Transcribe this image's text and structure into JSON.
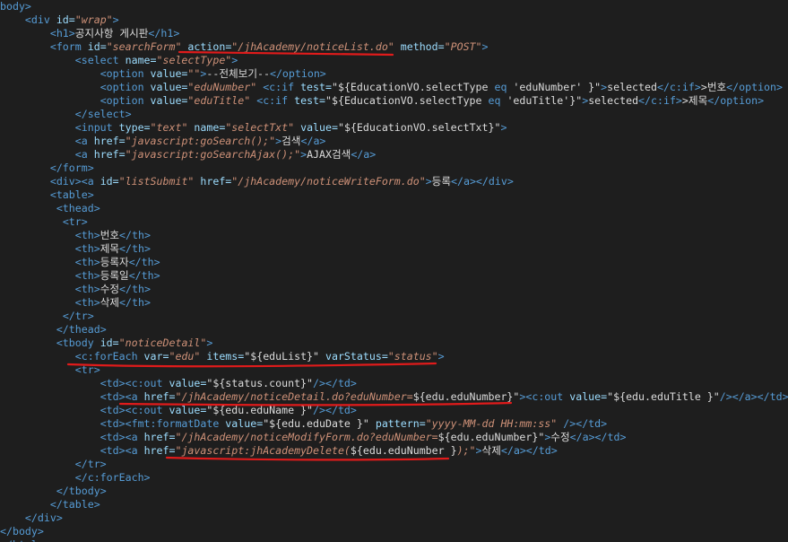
{
  "code_lines": [
    [
      [
        "tag",
        "body>"
      ]
    ],
    [
      [
        "txt",
        "    "
      ],
      [
        "tag",
        "<div "
      ],
      [
        "attr",
        "id="
      ],
      [
        "str",
        "\"wrap\""
      ],
      [
        "tag",
        ">"
      ]
    ],
    [
      [
        "txt",
        "        "
      ],
      [
        "tag",
        "<h1>"
      ],
      [
        "txt",
        "공지사항 게시판"
      ],
      [
        "tag",
        "</h1>"
      ]
    ],
    [
      [
        "txt",
        "        "
      ],
      [
        "tag",
        "<form "
      ],
      [
        "attr",
        "id="
      ],
      [
        "str",
        "\"searchForm\""
      ],
      [
        "attr",
        " action="
      ],
      [
        "str",
        "\"/jhAcademy/noticeList.do\""
      ],
      [
        "attr",
        " method="
      ],
      [
        "str",
        "\"POST\""
      ],
      [
        "tag",
        ">"
      ]
    ],
    [
      [
        "txt",
        "            "
      ],
      [
        "tag",
        "<select "
      ],
      [
        "attr",
        "name="
      ],
      [
        "str",
        "\"selectType\""
      ],
      [
        "tag",
        ">"
      ]
    ],
    [
      [
        "txt",
        "                "
      ],
      [
        "tag",
        "<option "
      ],
      [
        "attr",
        "value="
      ],
      [
        "str",
        "\"\""
      ],
      [
        "tag",
        ">"
      ],
      [
        "txt",
        "--전체보기--"
      ],
      [
        "tag",
        "</option>"
      ]
    ],
    [
      [
        "txt",
        "                "
      ],
      [
        "tag",
        "<option "
      ],
      [
        "attr",
        "value="
      ],
      [
        "str",
        "\"eduNumber\""
      ],
      [
        "txt",
        " "
      ],
      [
        "tag",
        "<c:if "
      ],
      [
        "attr",
        "test="
      ],
      [
        "txt",
        "\"${EducationVO.selectType "
      ],
      [
        "kw",
        "eq"
      ],
      [
        "txt",
        " 'eduNumber' }\""
      ],
      [
        "tag",
        ">"
      ],
      [
        "txt",
        "selected"
      ],
      [
        "tag",
        "</c:if>"
      ],
      [
        "txt",
        ">번호"
      ],
      [
        "tag",
        "</option>"
      ]
    ],
    [
      [
        "txt",
        "                "
      ],
      [
        "tag",
        "<option "
      ],
      [
        "attr",
        "value="
      ],
      [
        "str",
        "\"eduTitle\""
      ],
      [
        "txt",
        " "
      ],
      [
        "tag",
        "<c:if "
      ],
      [
        "attr",
        "test="
      ],
      [
        "txt",
        "\"${EducationVO.selectType "
      ],
      [
        "kw",
        "eq"
      ],
      [
        "txt",
        " 'eduTitle'}\""
      ],
      [
        "tag",
        ">"
      ],
      [
        "txt",
        "selected"
      ],
      [
        "tag",
        "</c:if>"
      ],
      [
        "txt",
        ">제목"
      ],
      [
        "tag",
        "</option>"
      ]
    ],
    [
      [
        "txt",
        "            "
      ],
      [
        "tag",
        "</select>"
      ]
    ],
    [
      [
        "txt",
        "            "
      ],
      [
        "tag",
        "<input "
      ],
      [
        "attr",
        "type="
      ],
      [
        "str",
        "\"text\""
      ],
      [
        "attr",
        " name="
      ],
      [
        "str",
        "\"selectTxt\""
      ],
      [
        "attr",
        " value="
      ],
      [
        "txt",
        "\"${EducationVO.selectTxt}\""
      ],
      [
        "tag",
        ">"
      ]
    ],
    [
      [
        "txt",
        "            "
      ],
      [
        "tag",
        "<a "
      ],
      [
        "attr",
        "href="
      ],
      [
        "str",
        "\"javascript:goSearch();\""
      ],
      [
        "tag",
        ">"
      ],
      [
        "txt",
        "검색"
      ],
      [
        "tag",
        "</a>"
      ]
    ],
    [
      [
        "txt",
        "            "
      ],
      [
        "tag",
        "<a "
      ],
      [
        "attr",
        "href="
      ],
      [
        "str",
        "\"javascript:goSearchAjax();\""
      ],
      [
        "tag",
        ">"
      ],
      [
        "txt",
        "AJAX검색"
      ],
      [
        "tag",
        "</a>"
      ]
    ],
    [
      [
        "txt",
        "        "
      ],
      [
        "tag",
        "</form>"
      ]
    ],
    [
      [
        "txt",
        "        "
      ],
      [
        "tag",
        "<div><a "
      ],
      [
        "attr",
        "id="
      ],
      [
        "str",
        "\"listSubmit\""
      ],
      [
        "attr",
        " href="
      ],
      [
        "str",
        "\"/jhAcademy/noticeWriteForm.do\""
      ],
      [
        "tag",
        ">"
      ],
      [
        "txt",
        "등록"
      ],
      [
        "tag",
        "</a></div>"
      ]
    ],
    [
      [
        "txt",
        "        "
      ],
      [
        "tag",
        "<table>"
      ]
    ],
    [
      [
        "txt",
        "         "
      ],
      [
        "tag",
        "<thead>"
      ]
    ],
    [
      [
        "txt",
        "          "
      ],
      [
        "tag",
        "<tr>"
      ]
    ],
    [
      [
        "txt",
        "            "
      ],
      [
        "tag",
        "<th>"
      ],
      [
        "txt",
        "번호"
      ],
      [
        "tag",
        "</th>"
      ]
    ],
    [
      [
        "txt",
        "            "
      ],
      [
        "tag",
        "<th>"
      ],
      [
        "txt",
        "제목"
      ],
      [
        "tag",
        "</th>"
      ]
    ],
    [
      [
        "txt",
        "            "
      ],
      [
        "tag",
        "<th>"
      ],
      [
        "txt",
        "등록자"
      ],
      [
        "tag",
        "</th>"
      ]
    ],
    [
      [
        "txt",
        "            "
      ],
      [
        "tag",
        "<th>"
      ],
      [
        "txt",
        "등록일"
      ],
      [
        "tag",
        "</th>"
      ]
    ],
    [
      [
        "txt",
        "            "
      ],
      [
        "tag",
        "<th>"
      ],
      [
        "txt",
        "수정"
      ],
      [
        "tag",
        "</th>"
      ]
    ],
    [
      [
        "txt",
        "            "
      ],
      [
        "tag",
        "<th>"
      ],
      [
        "txt",
        "삭제"
      ],
      [
        "tag",
        "</th>"
      ]
    ],
    [
      [
        "txt",
        "          "
      ],
      [
        "tag",
        "</tr>"
      ]
    ],
    [
      [
        "txt",
        "         "
      ],
      [
        "tag",
        "</thead>"
      ]
    ],
    [
      [
        "txt",
        "         "
      ],
      [
        "tag",
        "<tbody "
      ],
      [
        "attr",
        "id="
      ],
      [
        "str",
        "\"noticeDetail\""
      ],
      [
        "tag",
        ">"
      ]
    ],
    [
      [
        "txt",
        "            "
      ],
      [
        "tag",
        "<c:forEach "
      ],
      [
        "attr",
        "var="
      ],
      [
        "str",
        "\"edu\""
      ],
      [
        "attr",
        " items="
      ],
      [
        "txt",
        "\"${eduList}\""
      ],
      [
        "attr",
        " varStatus="
      ],
      [
        "str",
        "\"status\""
      ],
      [
        "tag",
        ">"
      ]
    ],
    [
      [
        "txt",
        "            "
      ],
      [
        "tag",
        "<tr>"
      ]
    ],
    [
      [
        "txt",
        "                "
      ],
      [
        "tag",
        "<td><c:out "
      ],
      [
        "attr",
        "value="
      ],
      [
        "txt",
        "\"${status.count}\""
      ],
      [
        "tag",
        "/></td>"
      ]
    ],
    [
      [
        "txt",
        "                "
      ],
      [
        "tag",
        "<td><a "
      ],
      [
        "attr",
        "href="
      ],
      [
        "str",
        "\"/jhAcademy/noticeDetail.do?eduNumber="
      ],
      [
        "txt",
        "${edu.eduNumber}\""
      ],
      [
        "tag",
        "><c:out "
      ],
      [
        "attr",
        "value="
      ],
      [
        "txt",
        "\"${edu.eduTitle }\""
      ],
      [
        "tag",
        "/></a></td>"
      ]
    ],
    [
      [
        "txt",
        "                "
      ],
      [
        "tag",
        "<td><c:out "
      ],
      [
        "attr",
        "value="
      ],
      [
        "txt",
        "\"${edu.eduName }\""
      ],
      [
        "tag",
        "/></td>"
      ]
    ],
    [
      [
        "txt",
        "                "
      ],
      [
        "tag",
        "<td><fmt:formatDate "
      ],
      [
        "attr",
        "value="
      ],
      [
        "txt",
        "\"${edu.eduDate }\""
      ],
      [
        "attr",
        " pattern="
      ],
      [
        "str",
        "\"yyyy-MM-dd HH:mm:ss\""
      ],
      [
        "tag",
        " /></td>"
      ]
    ],
    [
      [
        "txt",
        "                "
      ],
      [
        "tag",
        "<td><a "
      ],
      [
        "attr",
        "href="
      ],
      [
        "str",
        "\"/jhAcademy/noticeModifyForm.do?eduNumber="
      ],
      [
        "txt",
        "${edu.eduNumber}\""
      ],
      [
        "tag",
        ">"
      ],
      [
        "txt",
        "수정"
      ],
      [
        "tag",
        "</a></td>"
      ]
    ],
    [
      [
        "txt",
        "                "
      ],
      [
        "tag",
        "<td><a "
      ],
      [
        "attr",
        "href="
      ],
      [
        "str",
        "\"javascript:jhAcademyDelete("
      ],
      [
        "txt",
        "${edu.eduNumber }"
      ],
      [
        "str",
        ");\""
      ],
      [
        "tag",
        ">"
      ],
      [
        "txt",
        "삭제"
      ],
      [
        "tag",
        "</a></td>"
      ]
    ],
    [
      [
        "txt",
        "            "
      ],
      [
        "tag",
        "</tr>"
      ]
    ],
    [
      [
        "txt",
        "            "
      ],
      [
        "tag",
        "</c:forEach>"
      ]
    ],
    [
      [
        "txt",
        "         "
      ],
      [
        "tag",
        "</tbody>"
      ]
    ],
    [
      [
        "txt",
        "        "
      ],
      [
        "tag",
        "</table>"
      ]
    ],
    [
      [
        "txt",
        "    "
      ],
      [
        "tag",
        "</div>"
      ]
    ],
    [
      [
        "tag",
        "</body>"
      ]
    ],
    [
      [
        "tag",
        "</html>"
      ]
    ]
  ],
  "colors": {
    "background": "#1e1e1e",
    "tag": "#569cd6",
    "attribute": "#9cdcfe",
    "string": "#ce9178",
    "text": "#dcdcdc",
    "underline": "#e01b1b"
  }
}
